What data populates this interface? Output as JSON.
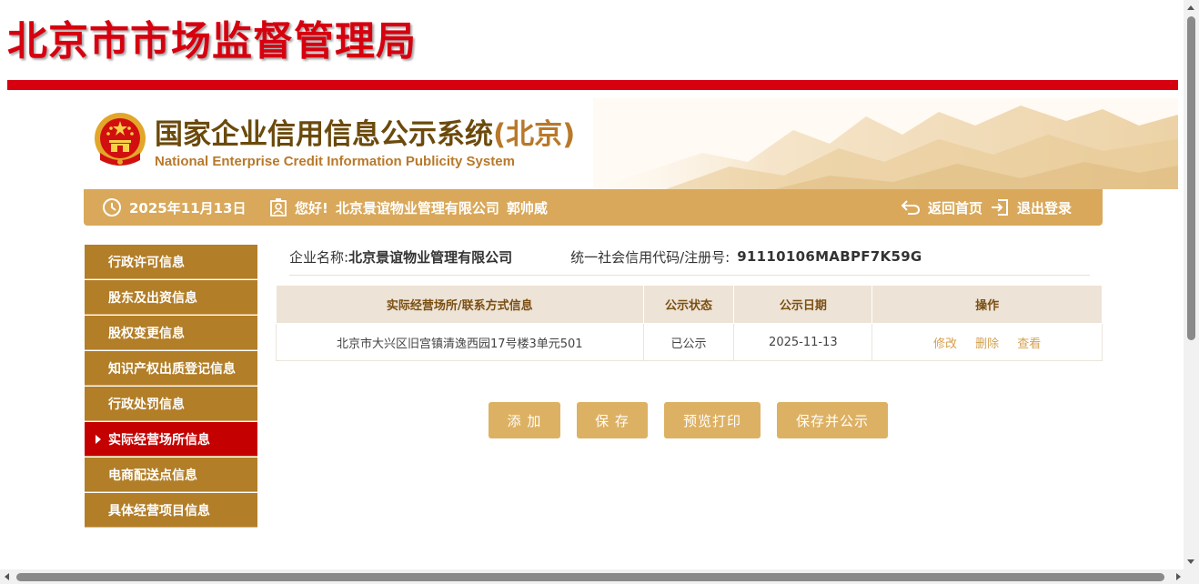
{
  "header": {
    "bureau_title": "北京市市场监督管理局",
    "system_title_cn": "国家企业信用信息公示系统",
    "system_title_region": "(北京)",
    "system_title_en": "National Enterprise Credit Information Publicity System"
  },
  "infobar": {
    "date": "2025年11月13日",
    "greeting": "您好!",
    "company": "北京景谊物业管理有限公司",
    "user": "郭帅威",
    "home_label": "返回首页",
    "logout_label": "退出登录"
  },
  "sidebar": {
    "items": [
      {
        "label": "行政许可信息"
      },
      {
        "label": "股东及出资信息"
      },
      {
        "label": "股权变更信息"
      },
      {
        "label": "知识产权出质登记信息"
      },
      {
        "label": "行政处罚信息"
      },
      {
        "label": "实际经营场所信息"
      },
      {
        "label": "电商配送点信息"
      },
      {
        "label": "具体经营项目信息"
      }
    ],
    "active_index": 5
  },
  "enterprise": {
    "name_label": "企业名称:",
    "name_value": "北京景谊物业管理有限公司",
    "code_label": "统一社会信用代码/注册号:",
    "code_value": "91110106MABPF7K59G"
  },
  "table": {
    "headers": [
      "实际经营场所/联系方式信息",
      "公示状态",
      "公示日期",
      "操作"
    ],
    "rows": [
      {
        "address": "北京市大兴区旧宫镇清逸西园17号楼3单元501",
        "status": "已公示",
        "date": "2025-11-13",
        "actions": [
          "修改",
          "删除",
          "查看"
        ]
      }
    ]
  },
  "buttons": {
    "add": "添 加",
    "save": "保 存",
    "preview": "预览打印",
    "save_publish": "保存并公示"
  },
  "colors": {
    "brand_red": "#d6000f",
    "gold_bar": "#d9a85a",
    "sidebar_brown": "#b27e27",
    "sidebar_active": "#c40000",
    "button_gold": "#ddb163"
  },
  "icons": {
    "date": "clock-icon",
    "user": "user-badge-icon",
    "home": "return-arrow-icon",
    "logout": "logout-icon",
    "emblem": "national-emblem-icon"
  }
}
